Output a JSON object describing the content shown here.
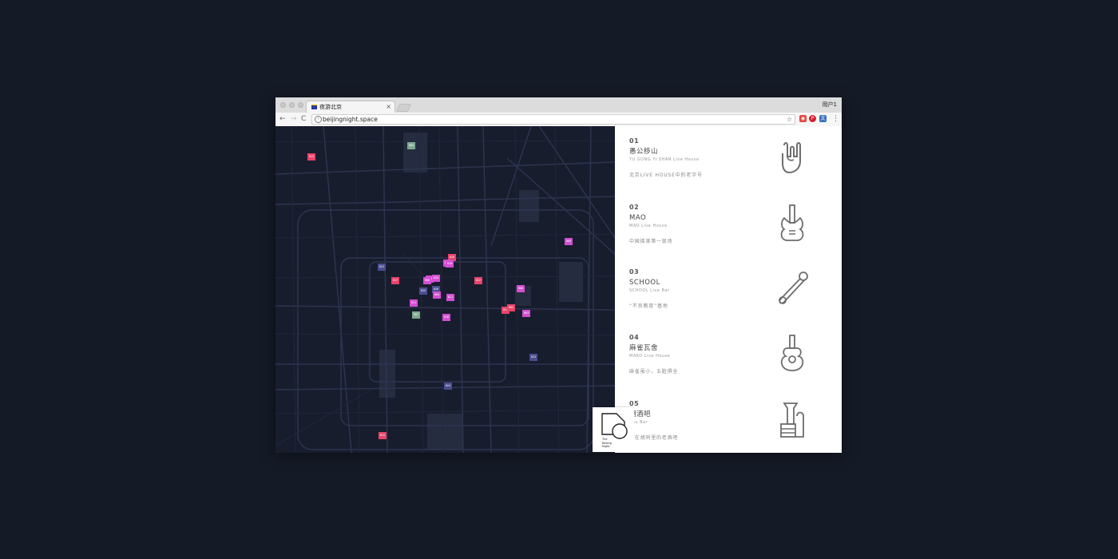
{
  "browser": {
    "tab_title": "夜游北京",
    "tab_close": "×",
    "user_label": "用户1",
    "url": "beijingnight.space",
    "nav": {
      "back": "←",
      "forward": "→",
      "reload": "C"
    },
    "star": "☆",
    "menu": "⋮",
    "extensions": [
      "speaker-ext-icon",
      "pinterest-ext-icon",
      "translate-ext-icon"
    ]
  },
  "map": {
    "markers": [
      {
        "id": "m1",
        "label": "013",
        "color": "#e9446a"
      },
      {
        "id": "m2",
        "label": "005",
        "color": "#7fa88f"
      },
      {
        "id": "m3",
        "label": "009",
        "color": "#d44fd2"
      },
      {
        "id": "m4",
        "label": "022",
        "color": "#4a4d8f"
      },
      {
        "id": "m5",
        "label": "016",
        "color": "#e9446a"
      },
      {
        "id": "m6",
        "label": "017",
        "color": "#e9446a"
      },
      {
        "id": "m7",
        "label": "001",
        "color": "#d44fd2"
      },
      {
        "id": "m8",
        "label": "019",
        "color": "#d44fd2"
      },
      {
        "id": "m9",
        "label": "020",
        "color": "#d44fd2"
      },
      {
        "id": "m10",
        "label": "012",
        "color": "#e9446a"
      },
      {
        "id": "m11",
        "label": "025",
        "color": "#4a4d8f"
      },
      {
        "id": "m12",
        "label": "026",
        "color": "#4a4d8f"
      },
      {
        "id": "m13",
        "label": "006",
        "color": "#d44fd2"
      },
      {
        "id": "m14",
        "label": "004",
        "color": "#d44fd2"
      },
      {
        "id": "m15",
        "label": "021",
        "color": "#d44fd2"
      },
      {
        "id": "m16",
        "label": "011",
        "color": "#d44fd2"
      },
      {
        "id": "m17",
        "label": "007",
        "color": "#7fa88f"
      },
      {
        "id": "m18",
        "label": "018",
        "color": "#d44fd2"
      },
      {
        "id": "m19",
        "label": "014",
        "color": "#e9446a"
      },
      {
        "id": "m20",
        "label": "002",
        "color": "#e9446a"
      },
      {
        "id": "m21",
        "label": "003",
        "color": "#d44fd2"
      },
      {
        "id": "m22",
        "label": "023",
        "color": "#4a4d8f"
      },
      {
        "id": "m23",
        "label": "024",
        "color": "#4a4d8f"
      },
      {
        "id": "m24",
        "label": "015",
        "color": "#e9446a"
      },
      {
        "id": "m25",
        "label": "010",
        "color": "#d44fd2"
      },
      {
        "id": "m26",
        "label": "008",
        "color": "#d44fd2"
      }
    ]
  },
  "venues": [
    {
      "num": "01",
      "name": "愚公移山",
      "en": "YU GONG YI SHAN Live House",
      "desc": "北京LIVE HOUSE中的老字号",
      "icon": "rock-hand-icon"
    },
    {
      "num": "02",
      "name": "MAO",
      "en": "MAO Live House",
      "desc": "中国摇滚第一现场",
      "icon": "electric-guitar-icon"
    },
    {
      "num": "03",
      "name": "SCHOOL",
      "en": "SCHOOL Live Bar",
      "desc": "“不良教育”基地",
      "icon": "safety-pin-icon"
    },
    {
      "num": "04",
      "name": "麻雀瓦舍",
      "en": "MAKO Live House",
      "desc": "麻雀虽小，五脏俱全",
      "icon": "acoustic-guitar-icon"
    },
    {
      "num": "05",
      "name": "湖酒吧",
      "en": "ghu Bar",
      "desc": "藏在胡同里的老酒吧",
      "icon": "instruments-icon"
    }
  ],
  "logo": {
    "text": "The\nBeijing\nNight"
  }
}
